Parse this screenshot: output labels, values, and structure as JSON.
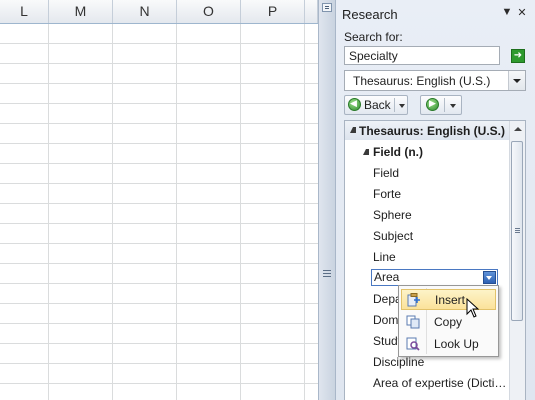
{
  "sheet": {
    "columns": [
      "L",
      "M",
      "N",
      "O",
      "P",
      ""
    ]
  },
  "pane": {
    "title": "Research",
    "search_label": "Search for:",
    "search_value": "Specialty",
    "source_selected": "Thesaurus: English (U.S.)",
    "back_label": "Back",
    "results": {
      "header": "Thesaurus: English (U.S.)",
      "sub_header": "Field (n.)",
      "words": [
        "Field",
        "Forte",
        "Sphere",
        "Subject",
        "Line",
        "Area",
        "Depa",
        "Doma",
        "Study",
        "Discipline",
        "Area of expertise (Dicti…"
      ],
      "selected_word": "Area"
    }
  },
  "context_menu": {
    "items": [
      {
        "label": "Insert",
        "icon": "insert-icon"
      },
      {
        "label": "Copy",
        "icon": "copy-icon"
      },
      {
        "label": "Look Up",
        "icon": "look-up-icon"
      }
    ]
  },
  "colors": {
    "pane_bg": "#e3e9f2",
    "highlight": "#fbe29a",
    "go_green": "#2e9a2e"
  }
}
